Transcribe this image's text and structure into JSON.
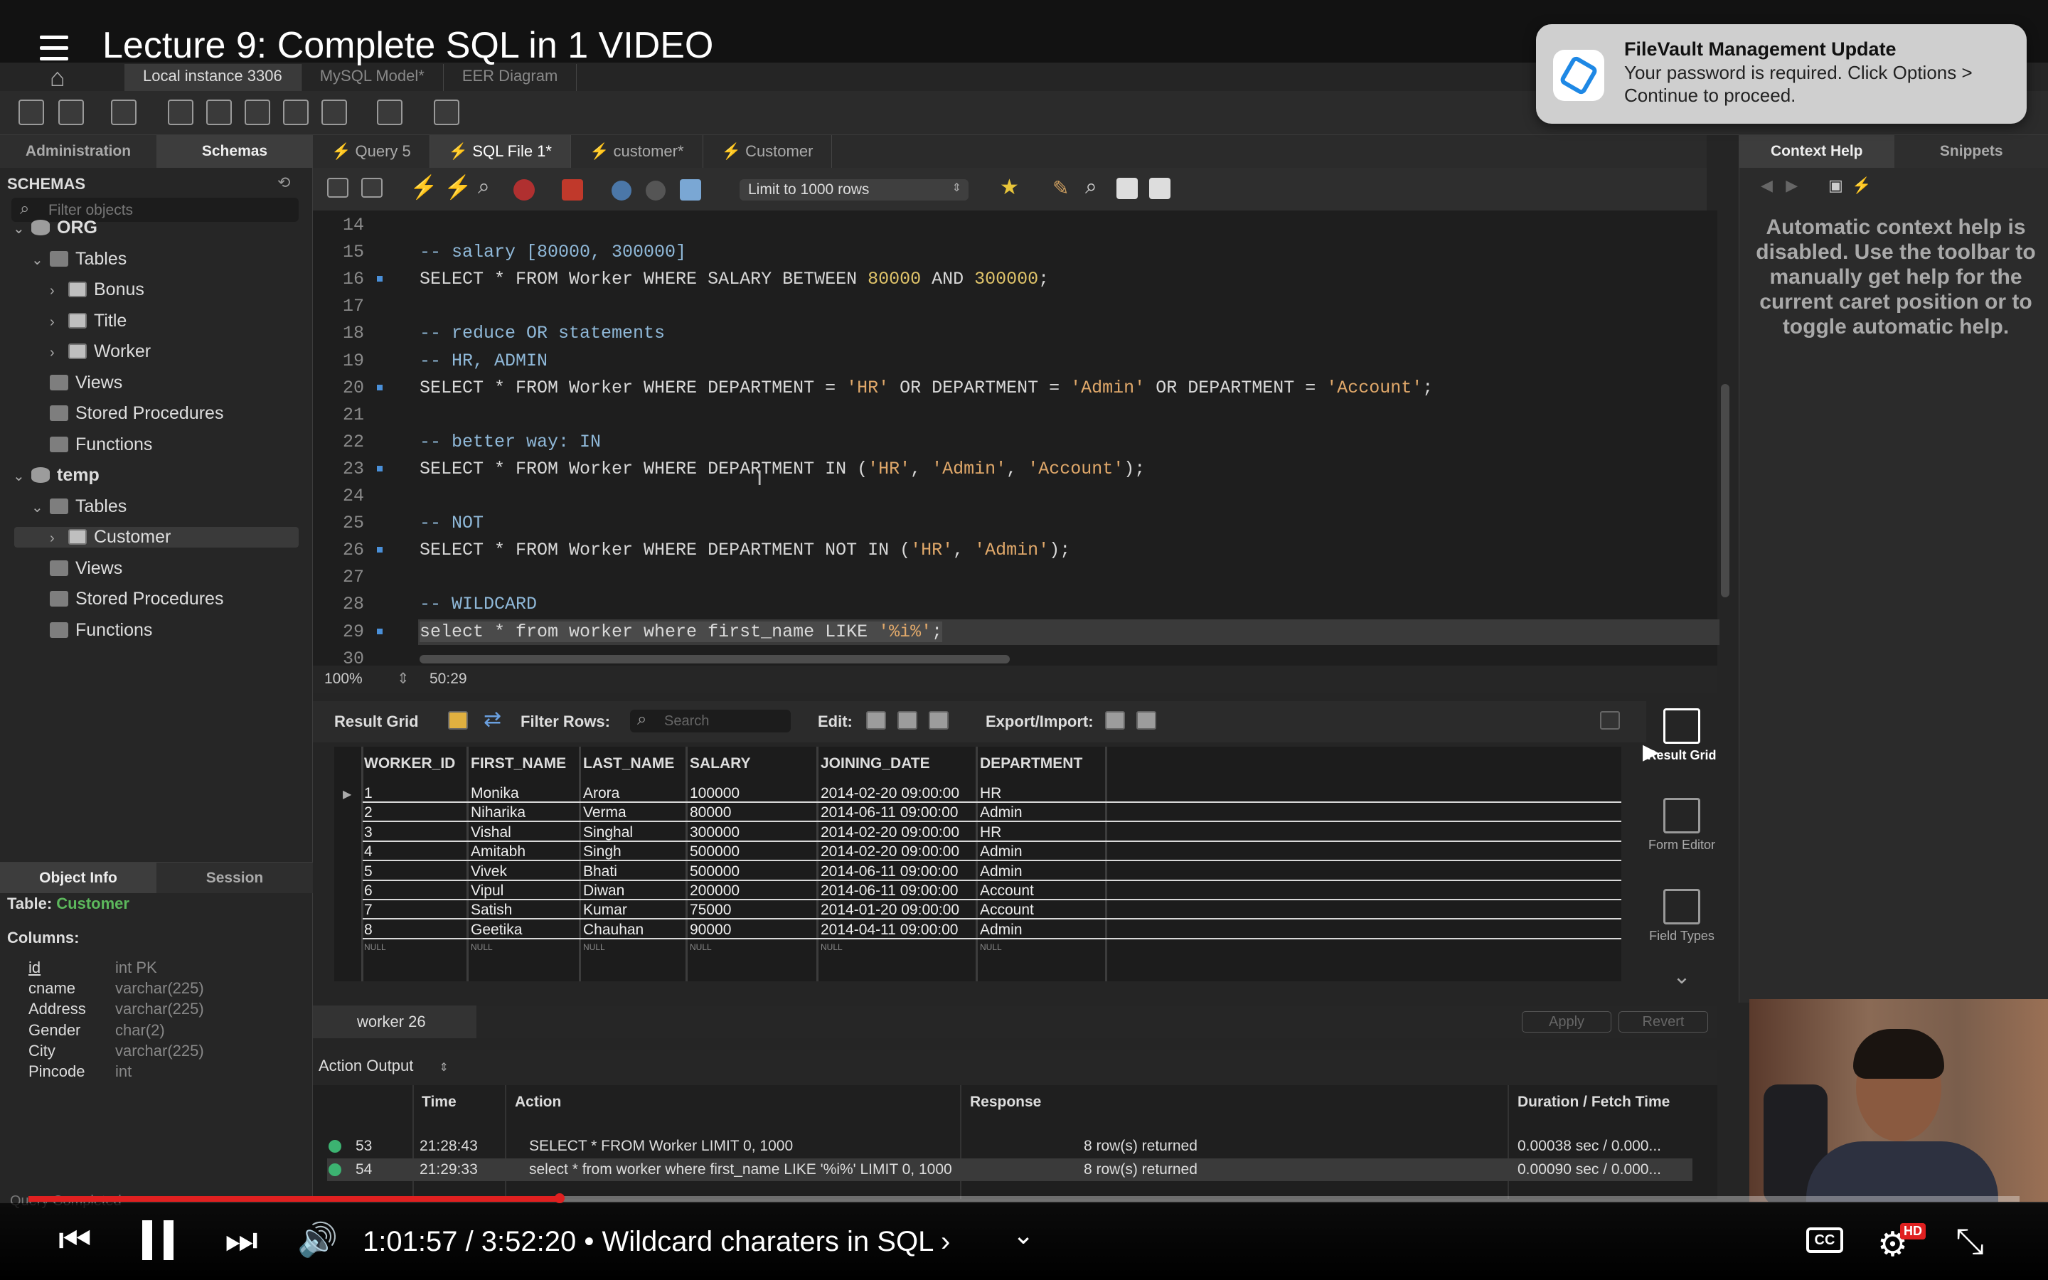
{
  "video": {
    "title": "Lecture 9: Complete SQL in 1 VIDEO",
    "current_time": "1:01:57",
    "duration": "3:52:20",
    "chapter": "Wildcard charaters in SQL",
    "time_display": "1:01:57 / 3:52:20 • Wildcard charaters in SQL ›",
    "progress": 0.2668,
    "hd_badge": "HD"
  },
  "notification": {
    "title": "FileVault Management Update",
    "body": "Your password is required. Click Options > Continue to proceed."
  },
  "connection_tabs": [
    "Local instance 3306",
    "MySQL Model*",
    "EER Diagram"
  ],
  "left_panel": {
    "tabs": [
      "Administration",
      "Schemas"
    ],
    "schemas_label": "SCHEMAS",
    "filter_placeholder": "Filter objects",
    "tree": [
      {
        "label": "ORG",
        "level": 0,
        "type": "db",
        "expanded": true
      },
      {
        "label": "Tables",
        "level": 1,
        "type": "folder",
        "expanded": true
      },
      {
        "label": "Bonus",
        "level": 2,
        "type": "table"
      },
      {
        "label": "Title",
        "level": 2,
        "type": "table"
      },
      {
        "label": "Worker",
        "level": 2,
        "type": "table"
      },
      {
        "label": "Views",
        "level": 1,
        "type": "folder"
      },
      {
        "label": "Stored Procedures",
        "level": 1,
        "type": "folder"
      },
      {
        "label": "Functions",
        "level": 1,
        "type": "folder"
      },
      {
        "label": "temp",
        "level": 0,
        "type": "db",
        "expanded": true
      },
      {
        "label": "Tables",
        "level": 1,
        "type": "folder",
        "expanded": true
      },
      {
        "label": "Customer",
        "level": 2,
        "type": "table",
        "selected": true
      },
      {
        "label": "Views",
        "level": 1,
        "type": "folder"
      },
      {
        "label": "Stored Procedures",
        "level": 1,
        "type": "folder"
      },
      {
        "label": "Functions",
        "level": 1,
        "type": "folder"
      }
    ],
    "object_tabs": [
      "Object Info",
      "Session"
    ],
    "table_label": "Table:",
    "table_name": "Customer",
    "columns_label": "Columns:",
    "columns": [
      {
        "name": "id",
        "type": "int PK"
      },
      {
        "name": "cname",
        "type": "varchar(225)"
      },
      {
        "name": "Address",
        "type": "varchar(225)"
      },
      {
        "name": "Gender",
        "type": "char(2)"
      },
      {
        "name": "City",
        "type": "varchar(225)"
      },
      {
        "name": "Pincode",
        "type": "int"
      }
    ]
  },
  "sql_tabs": [
    "Query 5",
    "SQL File 1*",
    "customer*",
    "Customer"
  ],
  "editor_toolbar": {
    "limit": "Limit to 1000 rows"
  },
  "editor": {
    "lines": [
      {
        "n": "14",
        "text": "",
        "mark": false
      },
      {
        "n": "15",
        "text": "-- salary [80000, 300000]",
        "mark": false
      },
      {
        "n": "16",
        "text": "SELECT * FROM Worker WHERE SALARY BETWEEN 80000 AND 300000;",
        "mark": true
      },
      {
        "n": "17",
        "text": "",
        "mark": false
      },
      {
        "n": "18",
        "text": "-- reduce OR statements",
        "mark": false
      },
      {
        "n": "19",
        "text": "-- HR, ADMIN",
        "mark": false
      },
      {
        "n": "20",
        "text": "SELECT * FROM Worker WHERE DEPARTMENT = 'HR' OR DEPARTMENT = 'Admin' OR DEPARTMENT = 'Account';",
        "mark": true
      },
      {
        "n": "21",
        "text": "",
        "mark": false
      },
      {
        "n": "22",
        "text": "-- better way: IN",
        "mark": false
      },
      {
        "n": "23",
        "text": "SELECT * FROM Worker WHERE DEPARTMENT IN ('HR', 'Admin', 'Account');",
        "mark": true
      },
      {
        "n": "24",
        "text": "",
        "mark": false
      },
      {
        "n": "25",
        "text": "-- NOT",
        "mark": false
      },
      {
        "n": "26",
        "text": "SELECT * FROM Worker WHERE DEPARTMENT NOT IN ('HR', 'Admin');",
        "mark": true
      },
      {
        "n": "27",
        "text": "",
        "mark": false
      },
      {
        "n": "28",
        "text": "-- WILDCARD",
        "mark": false
      },
      {
        "n": "29",
        "text": "select * from worker where first_name LIKE '%i%';",
        "mark": true,
        "highlighted": true
      },
      {
        "n": "30",
        "text": "",
        "mark": false
      }
    ],
    "zoom": "100%",
    "cursor_pos": "50:29"
  },
  "result": {
    "labels": {
      "result_grid": "Result Grid",
      "filter_rows": "Filter Rows:",
      "search_placeholder": "Search",
      "edit": "Edit:",
      "export_import": "Export/Import:"
    },
    "columns": [
      "WORKER_ID",
      "FIRST_NAME",
      "LAST_NAME",
      "SALARY",
      "JOINING_DATE",
      "DEPARTMENT"
    ],
    "rows": [
      [
        "1",
        "Monika",
        "Arora",
        "100000",
        "2014-02-20 09:00:00",
        "HR"
      ],
      [
        "2",
        "Niharika",
        "Verma",
        "80000",
        "2014-06-11 09:00:00",
        "Admin"
      ],
      [
        "3",
        "Vishal",
        "Singhal",
        "300000",
        "2014-02-20 09:00:00",
        "HR"
      ],
      [
        "4",
        "Amitabh",
        "Singh",
        "500000",
        "2014-02-20 09:00:00",
        "Admin"
      ],
      [
        "5",
        "Vivek",
        "Bhati",
        "500000",
        "2014-06-11 09:00:00",
        "Admin"
      ],
      [
        "6",
        "Vipul",
        "Diwan",
        "200000",
        "2014-06-11 09:00:00",
        "Account"
      ],
      [
        "7",
        "Satish",
        "Kumar",
        "75000",
        "2014-01-20 09:00:00",
        "Account"
      ],
      [
        "8",
        "Geetika",
        "Chauhan",
        "90000",
        "2014-04-11 09:00:00",
        "Admin"
      ]
    ],
    "null_label": "NULL",
    "side_buttons": [
      {
        "label": "Result Grid",
        "active": true
      },
      {
        "label": "Form Editor",
        "active": false
      },
      {
        "label": "Field Types",
        "active": false
      }
    ],
    "tab": "worker 26",
    "apply": "Apply",
    "revert": "Revert"
  },
  "output": {
    "selector": "Action Output",
    "columns": [
      "Time",
      "Action",
      "Response",
      "Duration / Fetch Time"
    ],
    "rows": [
      {
        "n": "53",
        "time": "21:28:43",
        "action": "SELECT * FROM Worker LIMIT 0, 1000",
        "response": "8 row(s) returned",
        "duration": "0.00038 sec / 0.000..."
      },
      {
        "n": "54",
        "time": "21:29:33",
        "action": "select * from worker where first_name LIKE '%i%' LIMIT 0, 1000",
        "response": "8 row(s) returned",
        "duration": "0.00090 sec / 0.000..."
      }
    ],
    "status": "Query Completed"
  },
  "right_panel": {
    "tabs": [
      "Context Help",
      "Snippets"
    ],
    "help_text": "Automatic context help is disabled. Use the toolbar to manually get help for the current caret position or to toggle automatic help."
  },
  "colors": {
    "accent_red": "#e02020",
    "comment": "#8fb8d8",
    "string": "#e0a86a",
    "ok_green": "#3cb371",
    "customer_green": "#5cb85c"
  }
}
